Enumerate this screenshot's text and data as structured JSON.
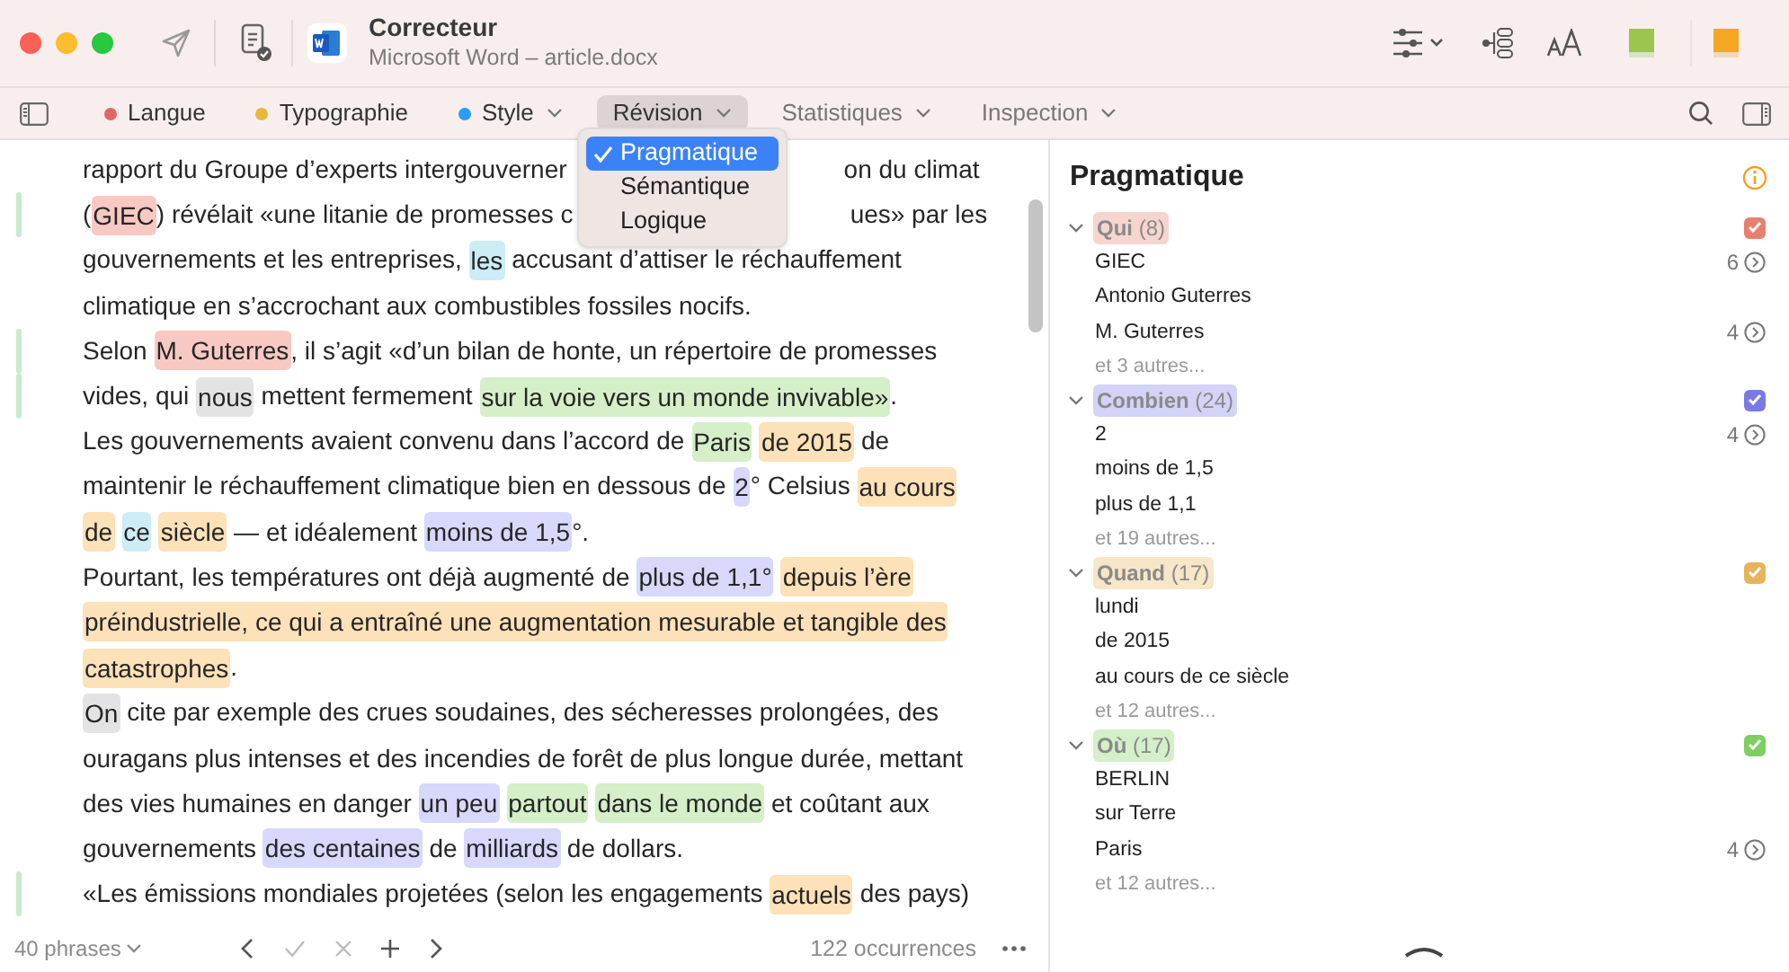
{
  "window": {
    "title": "Correcteur",
    "subtitle": "Microsoft Word – article.docx"
  },
  "tabs": [
    {
      "label": "Langue",
      "color": "#e06666",
      "has_menu": false,
      "selected": false
    },
    {
      "label": "Typographie",
      "color": "#e8b83a",
      "has_menu": false,
      "selected": false
    },
    {
      "label": "Style",
      "color": "#2b9cf0",
      "has_menu": true,
      "selected": false
    },
    {
      "label": "Révision",
      "has_menu": true,
      "selected": true
    },
    {
      "label": "Statistiques",
      "has_menu": true,
      "selected": false
    },
    {
      "label": "Inspection",
      "has_menu": true,
      "selected": false
    }
  ],
  "menu": [
    {
      "label": "Pragmatique",
      "selected": true
    },
    {
      "label": "Sémantique",
      "selected": false
    },
    {
      "label": "Logique",
      "selected": false
    }
  ],
  "document": {
    "lines": [
      {
        "change_bar": false,
        "segments": [
          {
            "text": "rapport du Groupe d’experts intergouverner"
          },
          {
            "text": "on du climat",
            "cut": true
          }
        ]
      },
      {
        "change_bar": true,
        "segments": [
          {
            "text": "("
          },
          {
            "text": "GIEC",
            "color": "#f8c9c3"
          },
          {
            "text": ") révélait «une litanie de promesses c"
          },
          {
            "text": "ues» par les",
            "cut": true
          }
        ]
      },
      {
        "change_bar": false,
        "segments": [
          {
            "text": "gouvernements et les entreprises, "
          },
          {
            "text": "les",
            "color": "#ccecf6"
          },
          {
            "text": " accusant d’attiser le réchauffement"
          }
        ]
      },
      {
        "change_bar": false,
        "segments": [
          {
            "text": "climatique en s’accrochant aux combustibles fossiles nocifs."
          }
        ]
      },
      {
        "change_bar": true,
        "segments": [
          {
            "text": "Selon "
          },
          {
            "text": "M. Guterres",
            "color": "#f8c9c3"
          },
          {
            "text": ", il s’agit «d’un bilan de honte, un répertoire de promesses"
          }
        ]
      },
      {
        "change_bar": true,
        "segments": [
          {
            "text": "vides, qui "
          },
          {
            "text": "nous",
            "color": "#e3e3e3"
          },
          {
            "text": " mettent fermement "
          },
          {
            "text": "sur la voie vers un monde invivable»",
            "color": "#d5efc9"
          },
          {
            "text": "."
          }
        ]
      },
      {
        "change_bar": false,
        "segments": [
          {
            "text": "Les gouvernements avaient convenu dans l’accord de "
          },
          {
            "text": "Paris",
            "color": "#d5efc9"
          },
          {
            "text": "de 2015",
            "color": "#fde1b8"
          },
          {
            "text": " de"
          }
        ]
      },
      {
        "change_bar": false,
        "segments": [
          {
            "text": "maintenir le réchauffement climatique bien en dessous de "
          },
          {
            "text": "2",
            "color": "#d7d8fb"
          },
          {
            "text": "° Celsius "
          },
          {
            "text": "au cours",
            "color": "#fde1b8"
          }
        ]
      },
      {
        "change_bar": false,
        "segments": [
          {
            "text": "de",
            "color": "#fde1b8"
          },
          {
            "text": "ce",
            "color": "#ccecf6"
          },
          {
            "text": "siècle",
            "color": "#fde1b8"
          },
          {
            "text": " — et idéalement "
          },
          {
            "text": "moins de 1,5",
            "color": "#d7d8fb"
          },
          {
            "text": "°."
          }
        ]
      },
      {
        "change_bar": false,
        "segments": [
          {
            "text": "Pourtant, les températures ont déjà augmenté de "
          },
          {
            "text": "plus de 1,1°",
            "color": "#d7d8fb"
          },
          {
            "text": "depuis l’ère",
            "color": "#fde1b8"
          }
        ]
      },
      {
        "change_bar": false,
        "segments": [
          {
            "text": "préindustrielle, ce qui a entraîné une augmentation mesurable et tangible des",
            "color": "#fde1b8"
          }
        ]
      },
      {
        "change_bar": false,
        "segments": [
          {
            "text": "catastrophes",
            "color": "#fde1b8"
          },
          {
            "text": "."
          }
        ]
      },
      {
        "change_bar": false,
        "segments": [
          {
            "text": "On",
            "color": "#e3e3e3"
          },
          {
            "text": " cite par exemple des crues soudaines, des sécheresses prolongées, des"
          }
        ]
      },
      {
        "change_bar": false,
        "segments": [
          {
            "text": "ouragans plus intenses et des incendies de forêt de plus longue durée, mettant"
          }
        ]
      },
      {
        "change_bar": false,
        "segments": [
          {
            "text": "des vies humaines en danger "
          },
          {
            "text": "un peu",
            "color": "#d7d8fb"
          },
          {
            "text": "partout",
            "color": "#d5efc9"
          },
          {
            "text": "dans le monde",
            "color": "#d5efc9"
          },
          {
            "text": " et coûtant aux"
          }
        ]
      },
      {
        "change_bar": false,
        "segments": [
          {
            "text": "gouvernements "
          },
          {
            "text": "des centaines",
            "color": "#d7d8fb"
          },
          {
            "text": " de "
          },
          {
            "text": "milliards",
            "color": "#d7d8fb"
          },
          {
            "text": " de dollars."
          }
        ]
      },
      {
        "change_bar": true,
        "segments": [
          {
            "text": "«Les émissions mondiales projetées (selon les engagements "
          },
          {
            "text": "actuels",
            "color": "#fde1b8"
          },
          {
            "text": " des pays)"
          }
        ]
      }
    ]
  },
  "footer": {
    "sentences": "40 phrases",
    "occurrences": "122 occurrences"
  },
  "panel": {
    "title": "Pragmatique",
    "groups": [
      {
        "name": "Qui",
        "count": "(8)",
        "color": "#e8806f",
        "checked": true,
        "expanded": true,
        "items": [
          {
            "label": "GIEC",
            "count": "6"
          },
          {
            "label": "Antonio Guterres"
          },
          {
            "label": "M. Guterres",
            "count": "4"
          }
        ],
        "more": "et 3 autres..."
      },
      {
        "name": "Combien",
        "count": "(24)",
        "color": "#7a7ae6",
        "checked": true,
        "expanded": true,
        "items": [
          {
            "label": "2",
            "count": "4"
          },
          {
            "label": "moins de 1,5"
          },
          {
            "label": "plus de 1,1"
          }
        ],
        "more": "et 19 autres..."
      },
      {
        "name": "Quand",
        "count": "(17)",
        "color": "#e6b45a",
        "checked": true,
        "expanded": true,
        "items": [
          {
            "label": "lundi"
          },
          {
            "label": "de 2015"
          },
          {
            "label": "au cours de ce siècle"
          }
        ],
        "more": "et 12 autres..."
      },
      {
        "name": "Où",
        "count": "(17)",
        "color": "#7dcf5f",
        "checked": true,
        "expanded": true,
        "items": [
          {
            "label": "BERLIN"
          },
          {
            "label": "sur Terre"
          },
          {
            "label": "Paris",
            "count": "4"
          }
        ],
        "more": "et 12 autres..."
      }
    ]
  }
}
